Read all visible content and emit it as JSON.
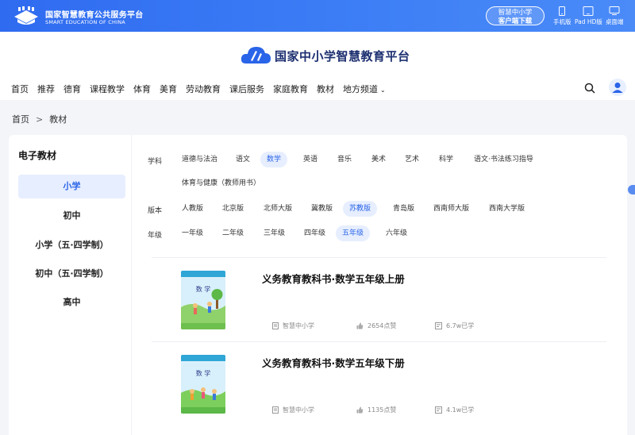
{
  "topbar": {
    "logo_cn": "国家智慧教育公共服务平台",
    "logo_en": "SMART EDUCATION OF CHINA",
    "download_line1": "智慧中小学",
    "download_line2": "客户端下载",
    "devices": [
      {
        "label": "手机版",
        "icon": "phone-icon"
      },
      {
        "label": "Pad HD版",
        "icon": "tablet-icon"
      },
      {
        "label": "桌面端",
        "icon": "desktop-icon"
      }
    ]
  },
  "header": {
    "site_title": "国家中小学智慧教育平台",
    "nav": [
      "首页",
      "推荐",
      "德育",
      "课程教学",
      "体育",
      "美育",
      "劳动教育",
      "课后服务",
      "家庭教育",
      "教材",
      "地方频道"
    ]
  },
  "breadcrumb": {
    "home": "首页",
    "separator": ">",
    "current": "教材"
  },
  "sidebar": {
    "title": "电子教材",
    "items": [
      "小学",
      "初中",
      "小学（五·四学制）",
      "初中（五·四学制）",
      "高中"
    ],
    "active_index": 0
  },
  "filters": {
    "subject_label": "学科",
    "subjects": [
      "道德与法治",
      "语文",
      "数学",
      "英语",
      "音乐",
      "美术",
      "艺术",
      "科学",
      "语文·书法练习指导",
      "体育与健康（教师用书）"
    ],
    "subject_active": "数学",
    "edition_label": "版本",
    "editions": [
      "人教版",
      "北京版",
      "北师大版",
      "冀教版",
      "苏教版",
      "青岛版",
      "西南师大版",
      "西南大学版"
    ],
    "edition_active": "苏教版",
    "grade_label": "年级",
    "grades": [
      "一年级",
      "二年级",
      "三年级",
      "四年级",
      "五年级",
      "六年级"
    ],
    "grade_active": "五年级"
  },
  "books": [
    {
      "title": "义务教育教科书·数学五年级上册",
      "source": "智慧中小学",
      "likes": "2654点赞",
      "learners": "6.7w已学",
      "cover_text": "数 学"
    },
    {
      "title": "义务教育教科书·数学五年级下册",
      "source": "智慧中小学",
      "likes": "1135点赞",
      "learners": "4.1w已学",
      "cover_text": "数 学"
    }
  ],
  "colors": {
    "accent": "#2a64e8",
    "topbar": "#3b7cf5",
    "chip_active_bg": "#e6eeff"
  }
}
